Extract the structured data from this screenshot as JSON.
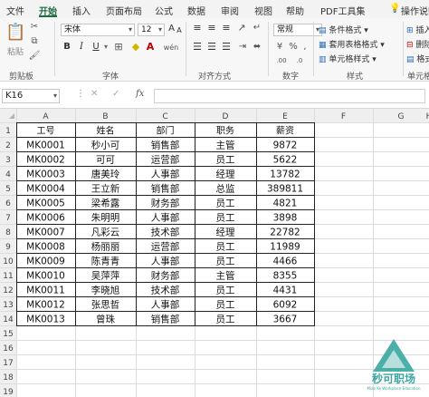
{
  "tabs": [
    "文件",
    "开始",
    "插入",
    "页面布局",
    "公式",
    "数据",
    "审阅",
    "视图",
    "帮助",
    "PDF工具集",
    "操作说明"
  ],
  "ribbon": {
    "paste_label": "粘贴",
    "font_name": "宋体",
    "font_size": "12",
    "font_size_up": "A",
    "font_size_down": "A",
    "bold": "B",
    "italic": "I",
    "underline": "U",
    "wen": "wén",
    "number_format": "常规",
    "conditional_format": "条件格式",
    "table_format": "套用表格格式",
    "cell_style": "单元格样式",
    "insert": "插入",
    "delete": "删除",
    "format": "格式",
    "groups": {
      "clipboard": "剪贴板",
      "font": "字体",
      "alignment": "对齐方式",
      "number": "数字",
      "styles": "样式",
      "cells": "单元格"
    }
  },
  "formula_bar": {
    "name_box": "K16",
    "fx": "fx",
    "cancel": "✕",
    "enter": "✓",
    "value": ""
  },
  "columns": [
    "A",
    "B",
    "C",
    "D",
    "E",
    "F",
    "G",
    "H"
  ],
  "rows": [
    "1",
    "2",
    "3",
    "4",
    "5",
    "6",
    "7",
    "8",
    "9",
    "10",
    "11",
    "12",
    "13",
    "14",
    "15",
    "16",
    "17",
    "18",
    "19",
    "20"
  ],
  "table": {
    "headers": [
      "工号",
      "姓名",
      "部门",
      "职务",
      "薪资"
    ],
    "data": [
      [
        "MK0001",
        "秒小可",
        "销售部",
        "主管",
        "9872"
      ],
      [
        "MK0002",
        "可可",
        "运营部",
        "员工",
        "5622"
      ],
      [
        "MK0003",
        "唐美玲",
        "人事部",
        "经理",
        "13782"
      ],
      [
        "MK0004",
        "王立新",
        "销售部",
        "总监",
        "389811"
      ],
      [
        "MK0005",
        "梁希露",
        "财务部",
        "员工",
        "4821"
      ],
      [
        "MK0006",
        "朱明明",
        "人事部",
        "员工",
        "3898"
      ],
      [
        "MK0007",
        "凡彩云",
        "技术部",
        "经理",
        "22782"
      ],
      [
        "MK0008",
        "杨丽丽",
        "运营部",
        "员工",
        "11989"
      ],
      [
        "MK0009",
        "陈青青",
        "人事部",
        "员工",
        "4466"
      ],
      [
        "MK0010",
        "吴萍萍",
        "财务部",
        "主管",
        "8355"
      ],
      [
        "MK0011",
        "李晓旭",
        "技术部",
        "员工",
        "4431"
      ],
      [
        "MK0012",
        "张思哲",
        "人事部",
        "员工",
        "6092"
      ],
      [
        "MK0013",
        "曾珠",
        "销售部",
        "员工",
        "3667"
      ]
    ]
  },
  "watermark": {
    "title": "秒可职场",
    "subtitle": "Miao Ke Workplace Education"
  },
  "colors": {
    "accent": "#1e6c41",
    "logo": "#3aa6a0"
  }
}
